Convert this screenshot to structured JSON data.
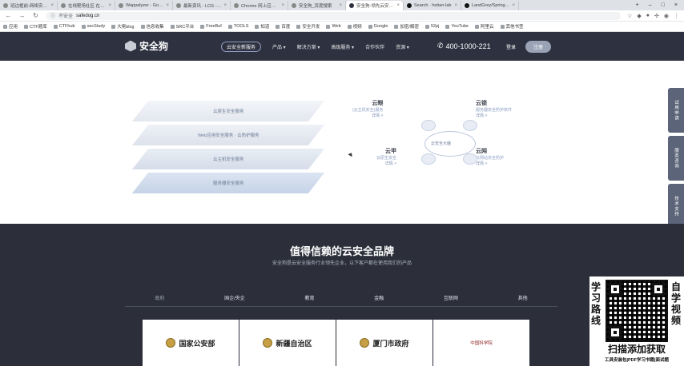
{
  "browser": {
    "tabs": [
      {
        "title": "班边框前-网络安全高..."
      },
      {
        "title": "在线靶场社区 在城..."
      },
      {
        "title": "Wappalyzer - Google..."
      },
      {
        "title": "最新资讯 - LCG - LSc..."
      },
      {
        "title": "Chrome 网上应用店..."
      },
      {
        "title": "安全狗_百度搜索"
      },
      {
        "title": "安全狗-领先云安全品..."
      },
      {
        "title": "Search · hetian-lab"
      },
      {
        "title": "LandGrey/SpringBo..."
      }
    ],
    "active_tab_index": 6,
    "address": {
      "security_label": "不安全",
      "url": "safedog.cn"
    },
    "bookmarks": [
      "应用",
      "CTF题库",
      "CTFhub",
      "secStudy",
      "大佬blog",
      "信息收集",
      "SRC平台",
      "FreeBuf",
      "TOOLS",
      "知道",
      "百度",
      "安全开发",
      "Web",
      "视频",
      "Google",
      "加密/解密",
      "52pj",
      "YouTube",
      "阿里云",
      "其他书签"
    ]
  },
  "site_header": {
    "brand": "安全狗",
    "nav_pill": "云安全新服务",
    "nav_items": [
      "产品 ▾",
      "解决方案 ▾",
      "高级服务 ▾",
      "合作伙伴",
      "资源 ▾"
    ],
    "phone": "400-1000-221",
    "login": "登录",
    "register": "注册"
  },
  "layers": [
    "云原生安全服务",
    "Web应用安全服务 · 云防护服务",
    "云主机安全服务",
    "服务器安全服务"
  ],
  "services": {
    "cloud_eye": {
      "title": "云眼",
      "desc": "(云主机安全)服务",
      "more": "详情 >"
    },
    "cloud_lock": {
      "title": "云锁",
      "desc": "服务器安全防护软件",
      "more": "详情 >"
    },
    "cloud_armor": {
      "title": "云甲",
      "desc": "云原生安全",
      "more": "详情 >"
    },
    "cloud_net": {
      "title": "云网",
      "desc": "云网站安全防护",
      "more": "详情 >"
    },
    "hub_label": "云安全大脑"
  },
  "side_tabs": [
    "试用申请",
    "服务咨询",
    "技术支持"
  ],
  "dark_section": {
    "title": "值得信赖的云安全品牌",
    "subtitle": "安全狗是云安全服务行业领先企业，以下客户都在使用我们的产品",
    "categories": [
      "政府",
      "国企/央企",
      "教育",
      "金融",
      "互联网",
      "其他"
    ],
    "active_category_index": 0,
    "cards": [
      "国家公安部",
      "新疆自治区",
      "厦门市政府",
      "中国科学院"
    ]
  },
  "qr_overlay": {
    "left_text": [
      "学",
      "习",
      "路",
      "线"
    ],
    "right_text": [
      "自",
      "学",
      "视",
      "频"
    ],
    "banner": "扫描添加获取",
    "footer": "工具安装包|PDF学习书籍|面试题"
  }
}
